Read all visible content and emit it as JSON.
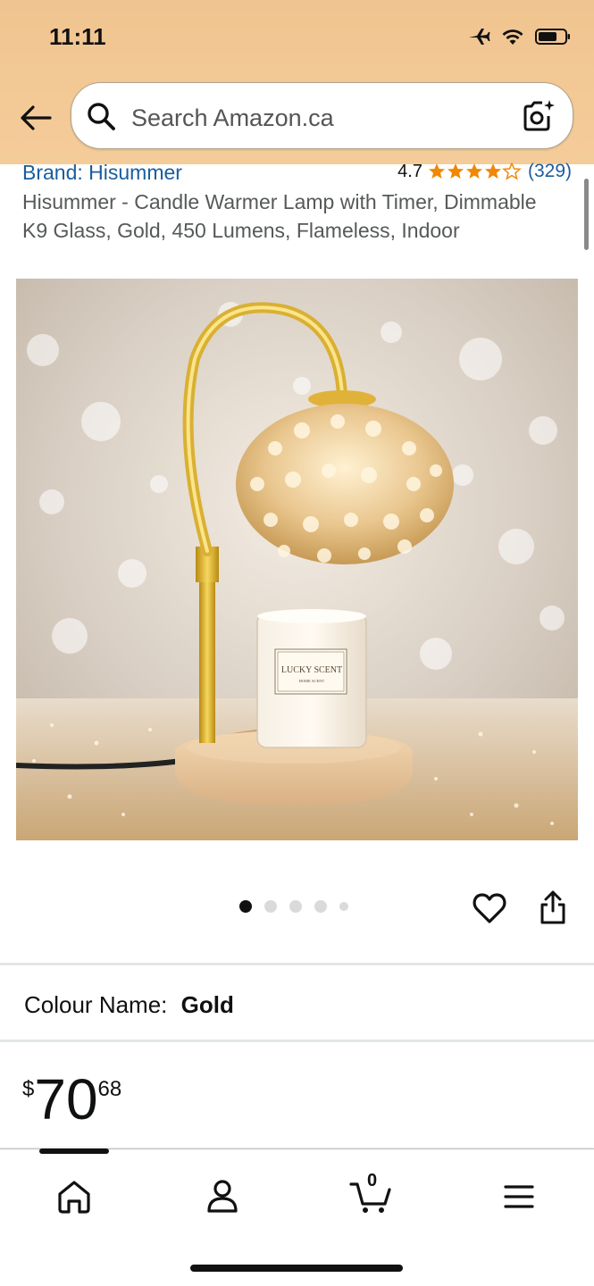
{
  "status_bar": {
    "time": "11:11",
    "icons": [
      "airplane-icon",
      "wifi-icon",
      "battery-icon"
    ]
  },
  "header": {
    "search_placeholder": "Search Amazon.ca",
    "background": "#f2c793"
  },
  "product": {
    "brand": "Brand: Hisummer",
    "rating": "4.7",
    "stars": 4.7,
    "review_count": "(329)",
    "title": "Hisummer - Candle Warmer Lamp with Timer, Dimmable K9 Glass, Gold, 450 Lumens, Flameless, Indoor",
    "image_dots": 5,
    "active_dot": 1,
    "candle_label": "LUCKY SCENT",
    "candle_sublabel": "HOME SCENT",
    "colour_label": "Colour Name:",
    "colour_value": "Gold",
    "price_symbol": "$",
    "price_whole": "70",
    "price_fraction": "68"
  },
  "bottom_nav": {
    "items": [
      "home-icon",
      "account-icon",
      "cart-icon",
      "menu-icon"
    ],
    "cart_count": "0"
  },
  "colors": {
    "link": "#1a5d9e",
    "star": "#f08804",
    "text": "#0f1111",
    "muted": "#565959"
  }
}
